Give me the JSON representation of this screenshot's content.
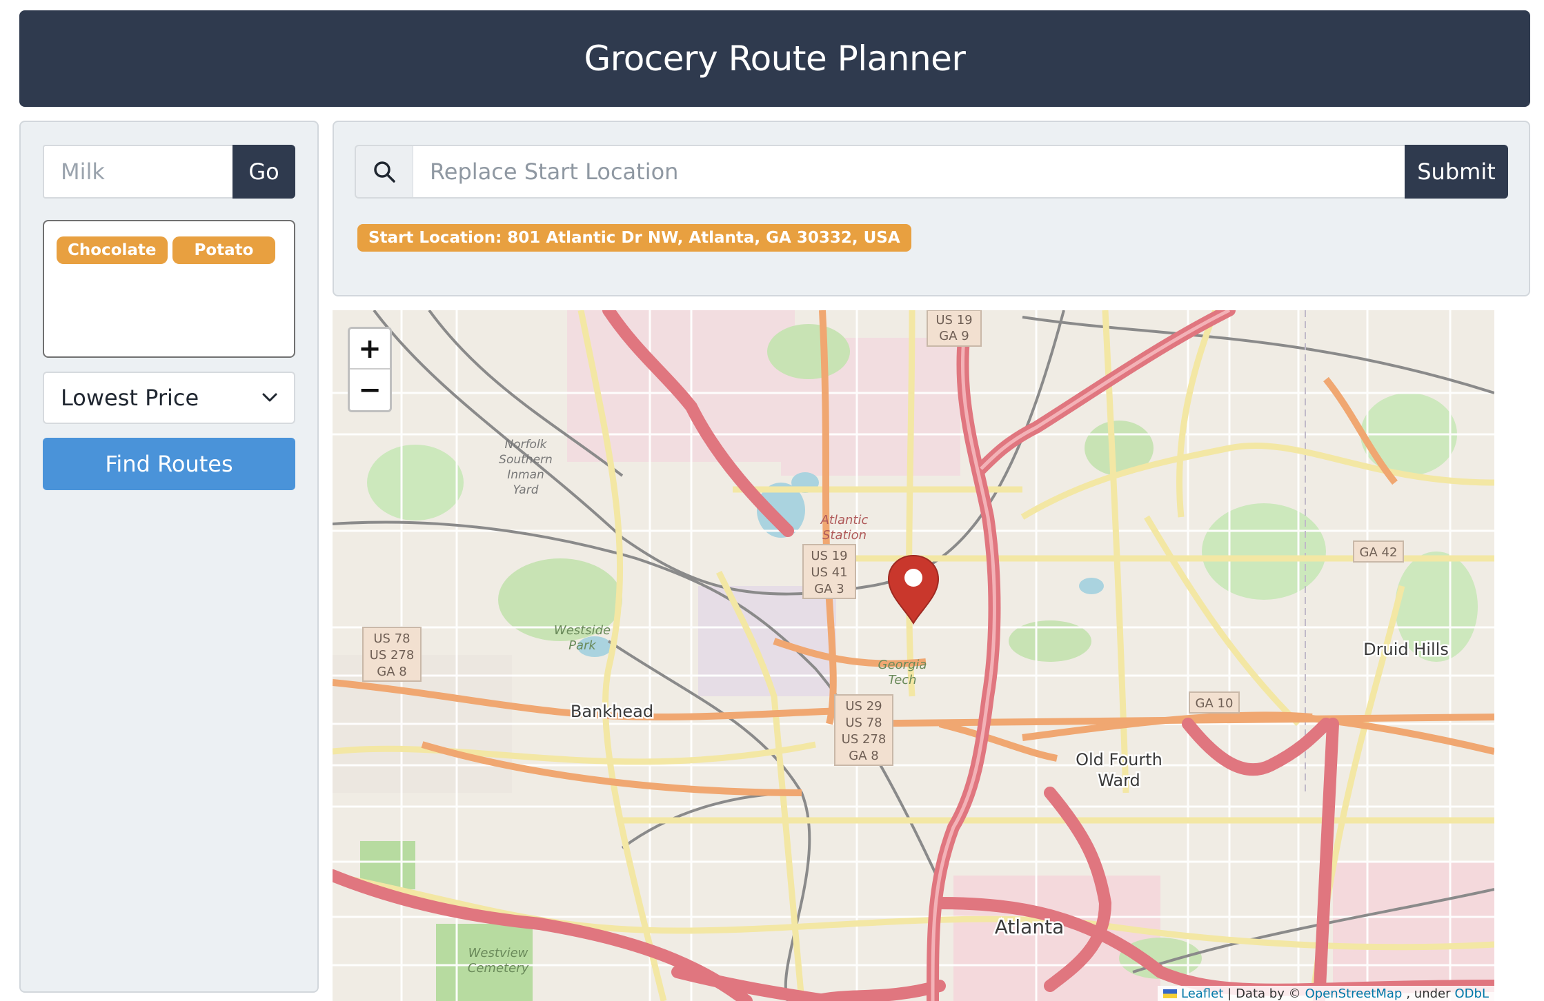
{
  "app": {
    "title": "Grocery Route Planner"
  },
  "item_search": {
    "placeholder": "Milk",
    "go_label": "Go"
  },
  "items": [
    "Chocolate",
    "Potato"
  ],
  "sort": {
    "selected": "Lowest Price"
  },
  "find_routes_label": "Find Routes",
  "location_search": {
    "placeholder": "Replace Start Location",
    "submit_label": "Submit",
    "icon": "search-icon"
  },
  "start_location_badge": "Start Location: 801 Atlantic Dr NW, Atlanta, GA 30332, USA",
  "map": {
    "zoom_in": "+",
    "zoom_out": "−",
    "attribution": {
      "leaflet": "Leaflet",
      "data_by": "| Data by ©",
      "osm": "OpenStreetMap",
      "under": ", under",
      "odbl": "ODbL"
    },
    "labels": {
      "atlanta": "Atlanta",
      "bankhead": "Bankhead",
      "druid_hills": "Druid Hills",
      "old_fourth_ward_1": "Old Fourth",
      "old_fourth_ward_2": "Ward",
      "georgia_1": "Georgia",
      "georgia_2": "Tech",
      "westside_1": "Westside",
      "westside_2": "Park",
      "westview_1": "Westview",
      "westview_2": "Cemetery",
      "atlantic_1": "Atlantic",
      "atlantic_2": "Station",
      "norfolk_1": "Norfolk",
      "norfolk_2": "Southern",
      "norfolk_3": "Inman",
      "norfolk_4": "Yard",
      "shield_us19_1": "US 19",
      "shield_us19_2": "GA 9",
      "shield_mid_1": "US 19",
      "shield_mid_2": "US 41",
      "shield_mid_3": "GA 3",
      "shield_west_1": "US 78",
      "shield_west_2": "US 278",
      "shield_west_3": "GA 8",
      "shield_south_1": "US 29",
      "shield_south_2": "US 78",
      "shield_south_3": "US 278",
      "shield_south_4": "GA 8",
      "shield_ga42": "GA 42",
      "shield_ga10": "GA 10"
    }
  },
  "colors": {
    "header_bg": "#2f3a4e",
    "accent_orange": "#e8a040",
    "primary_blue": "#4a93d9",
    "marker_red": "#c9372c"
  }
}
